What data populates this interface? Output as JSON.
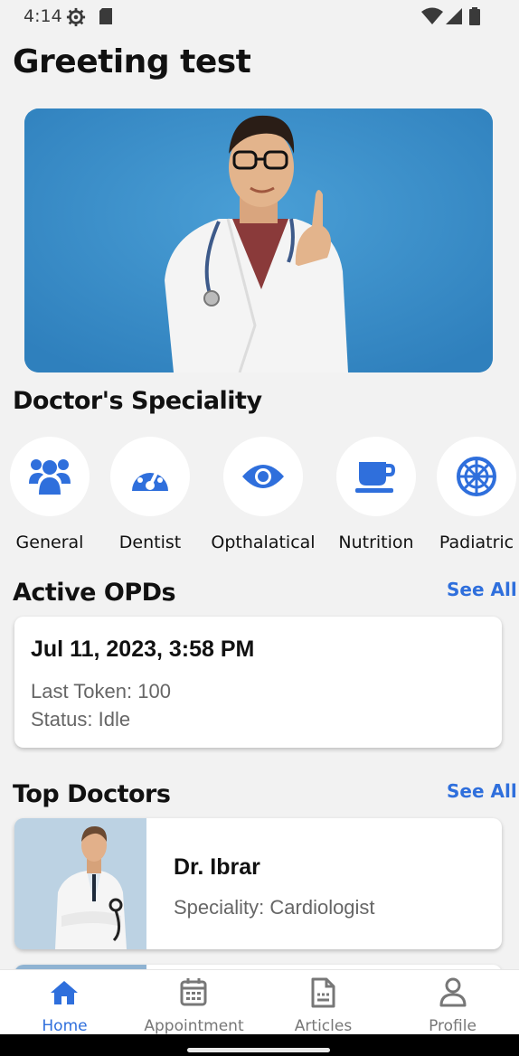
{
  "status_bar": {
    "time": "4:14"
  },
  "header": {
    "greeting": "Greeting test"
  },
  "speciality": {
    "title": "Doctor's Speciality",
    "items": [
      {
        "label": "General",
        "icon": "users-icon"
      },
      {
        "label": "Dentist",
        "icon": "gauge-icon"
      },
      {
        "label": "Opthalatical",
        "icon": "eye-icon"
      },
      {
        "label": "Nutrition",
        "icon": "coffee-cup-icon"
      },
      {
        "label": "Padiatric",
        "icon": "empire-icon"
      }
    ]
  },
  "active_opds": {
    "title": "Active OPDs",
    "see_all": "See All",
    "card": {
      "date": "Jul 11, 2023, 3:58 PM",
      "last_token": "Last Token: 100",
      "status": "Status: Idle"
    }
  },
  "top_doctors": {
    "title": "Top Doctors",
    "see_all": "See All",
    "doctors": [
      {
        "name": "Dr. Ibrar",
        "speciality": "Speciality: Cardiologist"
      }
    ]
  },
  "bottom_nav": {
    "items": [
      {
        "label": "Home",
        "active": true
      },
      {
        "label": "Appointment",
        "active": false
      },
      {
        "label": "Articles",
        "active": false
      },
      {
        "label": "Profile",
        "active": false
      }
    ]
  },
  "colors": {
    "accent": "#2f6fdc",
    "banner_bg": "#3a8fca",
    "background": "#f2f2f2"
  }
}
